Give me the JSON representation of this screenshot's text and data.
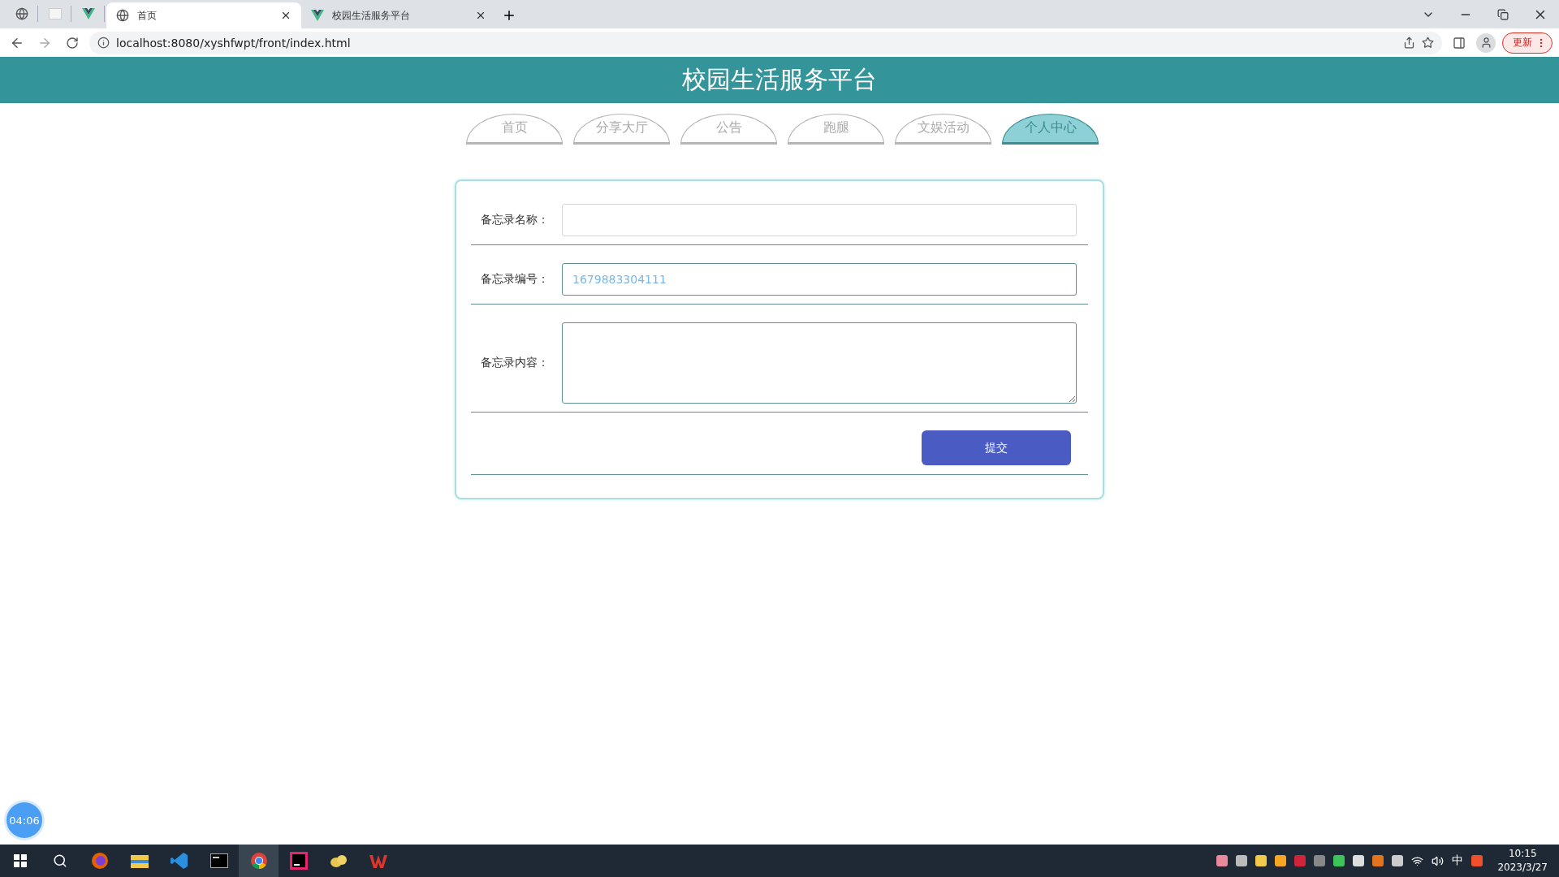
{
  "browser": {
    "tabs": [
      {
        "kind": "pinned",
        "selected": false
      },
      {
        "kind": "pinned",
        "selected": false
      },
      {
        "kind": "pinned",
        "selected": false
      },
      {
        "kind": "tab",
        "title": "首页",
        "selected": true
      },
      {
        "kind": "tab",
        "title": "校园生活服务平台",
        "selected": false
      }
    ],
    "address": "localhost:8080/xyshfwpt/front/index.html",
    "update_button": "更新"
  },
  "header": {
    "title": "校园生活服务平台"
  },
  "nav": [
    {
      "label": "首页",
      "selected": false
    },
    {
      "label": "分享大厅",
      "selected": false
    },
    {
      "label": "公告",
      "selected": false
    },
    {
      "label": "跑腿",
      "selected": false
    },
    {
      "label": "文娱活动",
      "selected": false
    },
    {
      "label": "个人中心",
      "selected": true
    }
  ],
  "form": {
    "fields": [
      {
        "kind": "input",
        "label": "备忘录名称："
      },
      {
        "kind": "input",
        "label": "备忘录编号：",
        "value": "1679883304111"
      },
      {
        "kind": "textarea",
        "label": "备忘录内容："
      }
    ],
    "submit": "提交"
  },
  "timer_badge": "04:06",
  "taskbar": {
    "tray_input": "中",
    "time": "10:15",
    "date": "2023/3/27"
  }
}
